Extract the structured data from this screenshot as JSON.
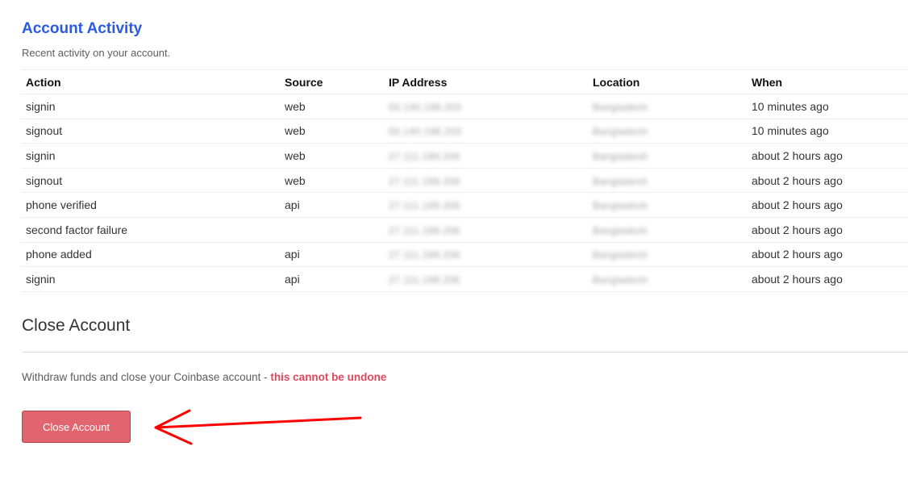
{
  "activity": {
    "title": "Account Activity",
    "subtitle": "Recent activity on your account.",
    "columns": [
      "Action",
      "Source",
      "IP Address",
      "Location",
      "When"
    ],
    "rows": [
      {
        "action": "signin",
        "source": "web",
        "ip": "50.140.198.203",
        "location": "Bangladesh",
        "when": "10 minutes ago"
      },
      {
        "action": "signout",
        "source": "web",
        "ip": "50.140.198.203",
        "location": "Bangladesh",
        "when": "10 minutes ago"
      },
      {
        "action": "signin",
        "source": "web",
        "ip": "27.111.199.206",
        "location": "Bangladesh",
        "when": "about 2 hours ago"
      },
      {
        "action": "signout",
        "source": "web",
        "ip": "27.111.199.206",
        "location": "Bangladesh",
        "when": "about 2 hours ago"
      },
      {
        "action": "phone verified",
        "source": "api",
        "ip": "27.111.199.206",
        "location": "Bangladesh",
        "when": "about 2 hours ago"
      },
      {
        "action": "second factor failure",
        "source": "",
        "ip": "27.111.199.206",
        "location": "Bangladesh",
        "when": "about 2 hours ago"
      },
      {
        "action": "phone added",
        "source": "api",
        "ip": "27.111.199.206",
        "location": "Bangladesh",
        "when": "about 2 hours ago"
      },
      {
        "action": "signin",
        "source": "api",
        "ip": "27.111.199.206",
        "location": "Bangladesh",
        "when": "about 2 hours ago"
      }
    ]
  },
  "close_account": {
    "title": "Close Account",
    "description": "Withdraw funds and close your Coinbase account - ",
    "warning": "this cannot be undone",
    "button_label": "Close Account"
  },
  "colors": {
    "link": "#2b5be0",
    "danger": "#e0475c",
    "button_bg": "#e0656f",
    "annotation_arrow": "#ff0000"
  }
}
